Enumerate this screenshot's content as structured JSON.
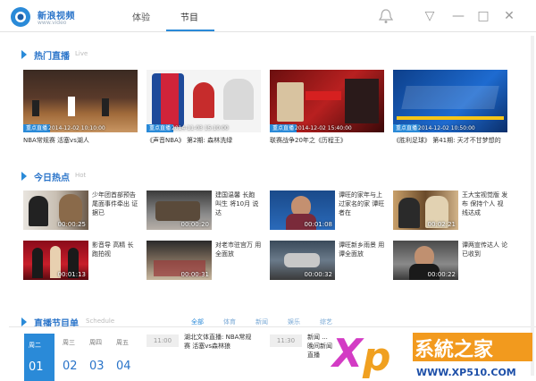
{
  "app": {
    "name": "新浪视频",
    "sub": "www.video"
  },
  "tabs": [
    {
      "label": "体验"
    },
    {
      "label": "节目"
    }
  ],
  "window": {
    "menu": "▽",
    "minimize": "—",
    "maximize": "□",
    "close": "✕"
  },
  "hot_live": {
    "title": "热门直播",
    "sub": "Live",
    "items": [
      {
        "badge": "重点直播",
        "time": "2014-12-02 10:10:00",
        "title": "NBA常规赛 活塞vs湖人"
      },
      {
        "badge": "重点直播",
        "time": "2014-11-03 15:10:00",
        "title": "《声音NBA》 第2期: 森林洗绿"
      },
      {
        "badge": "重点直播",
        "time": "2014-12-02 15:40:00",
        "title": "联赛战争20年之《历程王》"
      },
      {
        "badge": "重点直播",
        "time": "2014-12-02 10:50:00",
        "title": "《胜利足球》 第41期: 天才不甘梦想的"
      }
    ]
  },
  "today_hot": {
    "title": "今日热点",
    "sub": "Hot",
    "items": [
      {
        "dur": "00:00:25",
        "text": "少年团首部预告 尾面事件牵出 证据已"
      },
      {
        "dur": "00:00:20",
        "text": "建国温馨 长跑 叫生 将10月 说达"
      },
      {
        "dur": "00:01:08",
        "text": "谭旺的家年与上 过家名的家 谭旺 者在"
      },
      {
        "dur": "00:02:21",
        "text": "王大宝视觉版 发布 保持个人 视线达成"
      },
      {
        "dur": "00:01:13",
        "text": "影音导 高精 长跑拍视"
      },
      {
        "dur": "00:00:31",
        "text": "对老市驻宫万 用全面放"
      },
      {
        "dur": "00:00:32",
        "text": "谭旺新乡雨景 用谭全面放"
      },
      {
        "dur": "00:00:22",
        "text": "谭两宣传达人 论已收到"
      }
    ]
  },
  "schedule": {
    "title": "直播节目单",
    "sub": "Schedule",
    "tabs": [
      "全部",
      "体育",
      "新闻",
      "娱乐",
      "综艺"
    ],
    "active_day": "周二",
    "days": [
      {
        "label": "周二",
        "num": "01"
      },
      {
        "label": "周三",
        "num": "02"
      },
      {
        "label": "周四",
        "num": "03"
      },
      {
        "label": "周五",
        "num": "04"
      }
    ],
    "programs": [
      {
        "time": "11:00",
        "text": "湖北文体直播: NBA常规赛 活塞vs森林狼"
      },
      {
        "time": "11:30",
        "text": "新闻 ... 晚间新闻直播"
      }
    ]
  },
  "watermark": {
    "big": "XP系统之家",
    "url": "WWW.XP510.COM"
  },
  "colors": {
    "accent": "#2a8ad8",
    "brand": "#2a74c9"
  }
}
